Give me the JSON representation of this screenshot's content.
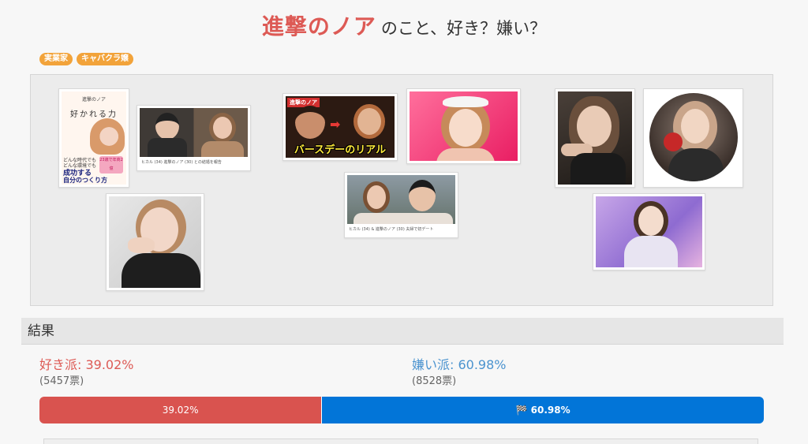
{
  "header": {
    "subject": "進撃のノア",
    "question": "のこと、好き？嫌い？"
  },
  "tags": [
    {
      "label": "実業家"
    },
    {
      "label": "キャバクラ嬢"
    }
  ],
  "gallery": {
    "book_title_small": "進撃のノア",
    "book_title_large": "好かれる力",
    "book_line1": "どんな時代でも",
    "book_line2": "どんな環境でも",
    "book_line3": "成功する",
    "book_line4": "自分のつくり方",
    "book_badge": "23歳で年商2億",
    "caption_hikaru_1": "ヒカル (34) 進撃のノア (30) との結婚を報告",
    "video_top_label": "進撃のノア",
    "video_title": "バースデーのリアル",
    "caption_hikaru_2": "ヒカル (34) & 進撃のノア (30) 夫婦で初デート"
  },
  "results": {
    "heading": "結果",
    "like_label": "好き派: 39.02%",
    "like_votes": "(5457票)",
    "dislike_label": "嫌い派: 60.98%",
    "dislike_votes": "(8528票)",
    "bar_like_text": "39.02%",
    "bar_dislike_text": "🏁 60.98%",
    "like_fraction": 0.3902,
    "dislike_fraction": 0.6098
  },
  "colors": {
    "accent_red": "#dd5a55",
    "accent_blue": "#0275d8",
    "tag_orange": "#f2a33a"
  }
}
